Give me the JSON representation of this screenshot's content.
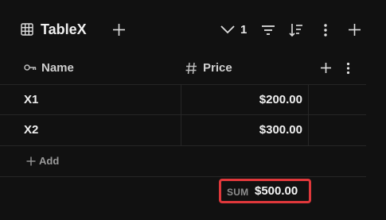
{
  "header": {
    "title": "TableX",
    "hidden_count": "1",
    "icons": [
      "table-icon",
      "plus-icon",
      "chevron-down-icon",
      "filter-icon",
      "sort-icon",
      "more-vertical-icon",
      "plus-icon"
    ]
  },
  "columns": [
    {
      "label": "Name",
      "icon": "key-icon"
    },
    {
      "label": "Price",
      "icon": "hash-icon"
    }
  ],
  "rows": [
    {
      "name": "X1",
      "price": "$200.00"
    },
    {
      "name": "X2",
      "price": "$300.00"
    }
  ],
  "add_row_label": "Add",
  "summary": {
    "label": "SUM",
    "value": "$500.00",
    "highlight_color": "#e0383b"
  }
}
